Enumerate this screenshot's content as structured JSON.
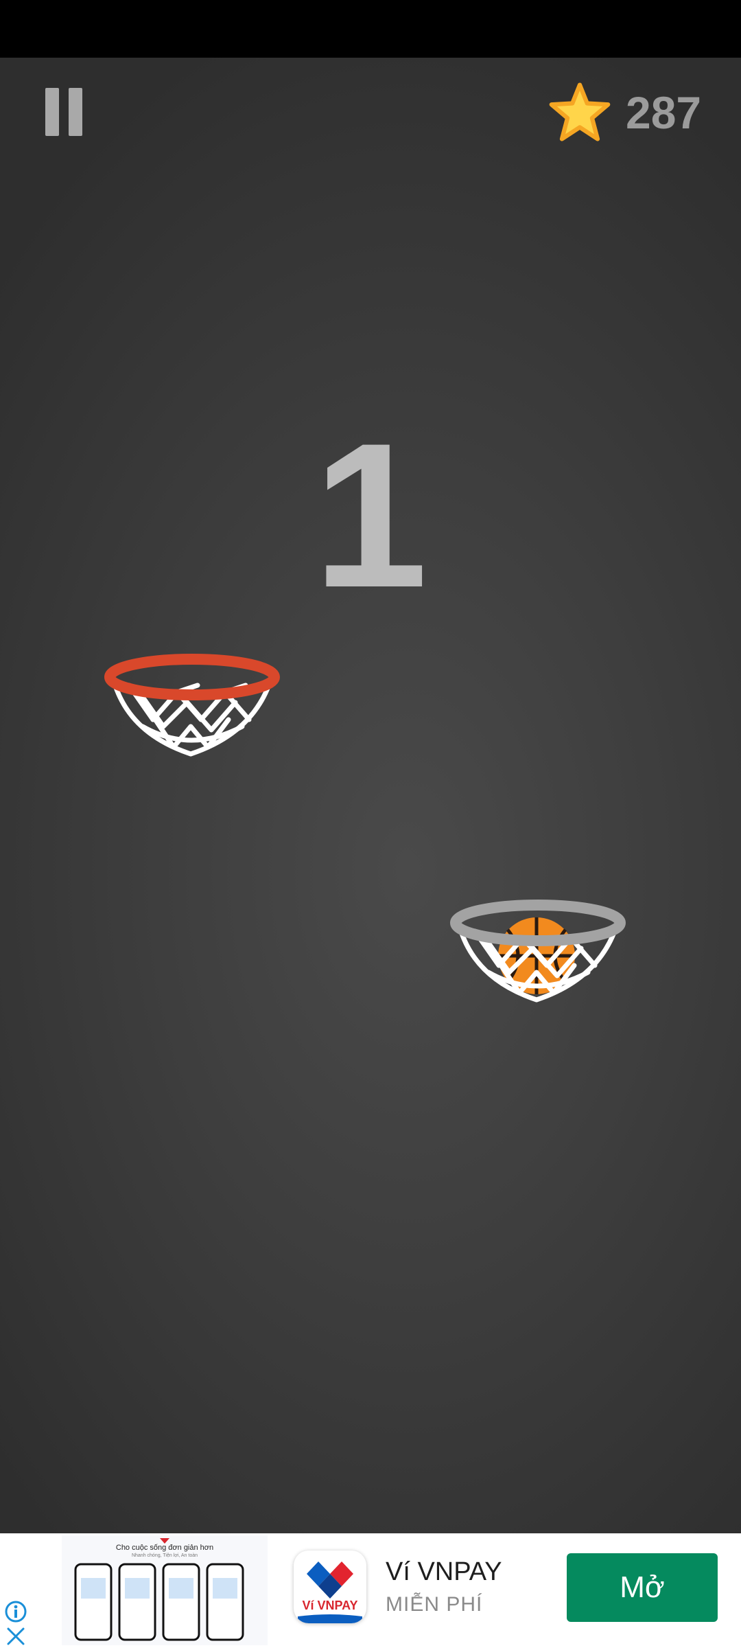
{
  "game": {
    "star_count": "287",
    "current_score": "1"
  },
  "icons": {
    "pause": "pause-icon",
    "star": "star-icon",
    "ball": "basketball-icon",
    "info": "info-icon",
    "close": "close-icon"
  },
  "colors": {
    "background": "#3e3e3e",
    "active_rim": "#d9482b",
    "inactive_rim": "#a3a3a3",
    "star_fill": "#ffd54a",
    "star_outline": "#f5a623",
    "ad_button": "#058a5e"
  },
  "ad": {
    "creative_title": "Cho cuộc sống đơn giản hơn",
    "creative_subtitle": "Nhanh chóng, Tiện lợi, An toàn",
    "app_icon_label": "Ví VNPAY",
    "app_name": "Ví VNPAY",
    "price": "MIỄN PHÍ",
    "cta": "Mở"
  }
}
